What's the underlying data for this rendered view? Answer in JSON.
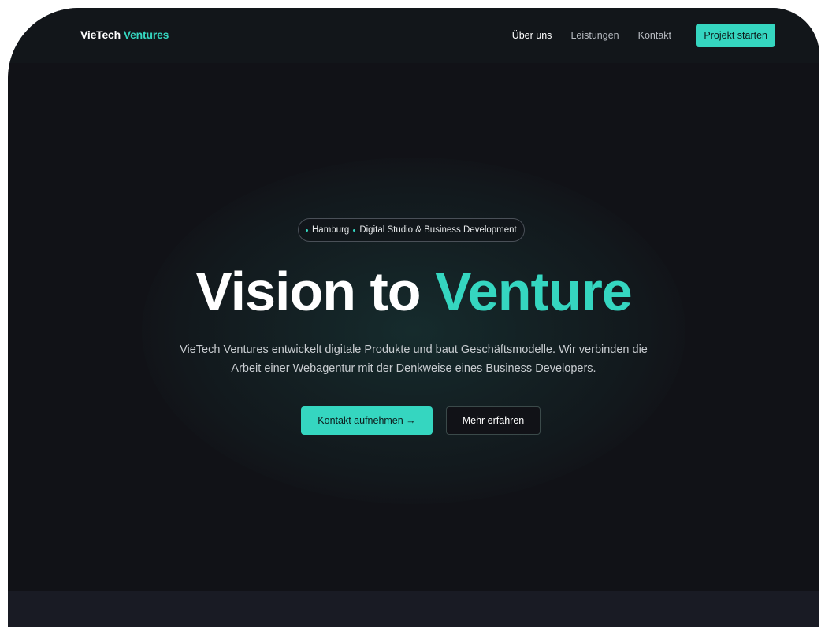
{
  "nav": {
    "brand_primary": "VieTech",
    "brand_accent": "Ventures",
    "links": [
      "Über uns",
      "Leistungen",
      "Kontakt"
    ],
    "cta_label": "Projekt starten"
  },
  "hero": {
    "badge_location": "Hamburg",
    "badge_text": "Digital Studio & Business Development",
    "headline_plain": "Vision to",
    "headline_accent": "Venture",
    "subtext_line1": "VieTech Ventures entwickelt digitale Produkte und baut Geschäftsmodelle. Wir verbinden die",
    "subtext_line2": "Arbeit einer Webagentur mit der Denkweise eines Business Developers.",
    "primary_button": "Kontakt aufnehmen →",
    "secondary_button": "Mehr erfahren"
  },
  "colors": {
    "accent": "#35d6c0",
    "background": "#111217",
    "nav_background": "#12161a"
  }
}
